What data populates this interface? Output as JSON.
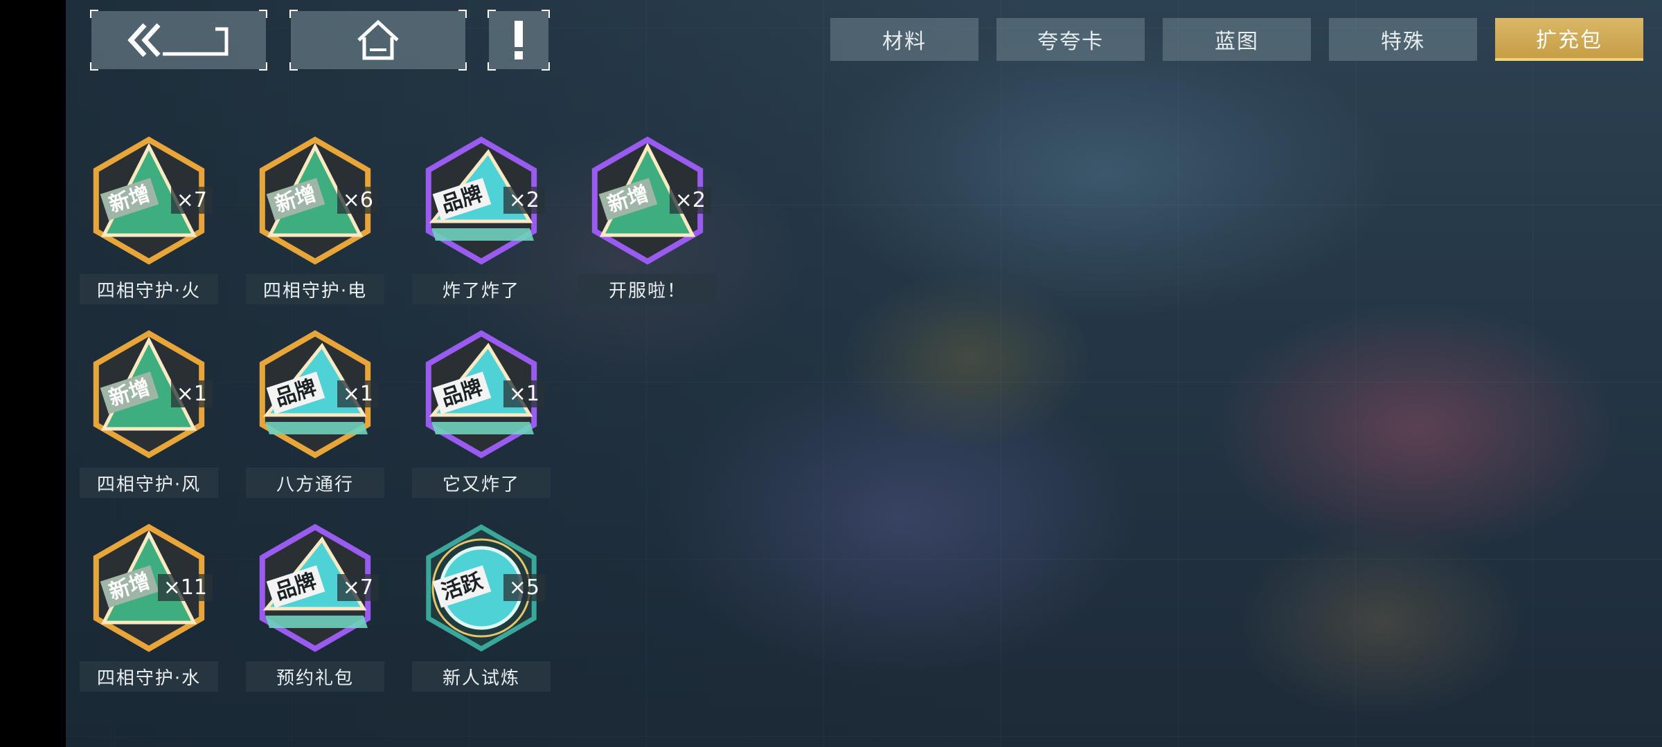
{
  "nav": {
    "back_icon": "double-chevron-back-icon",
    "home_icon": "home-icon",
    "info_icon": "exclamation-icon"
  },
  "tabs": [
    {
      "label": "材料",
      "active": false
    },
    {
      "label": "夸夸卡",
      "active": false
    },
    {
      "label": "蓝图",
      "active": false
    },
    {
      "label": "特殊",
      "active": false
    },
    {
      "label": "扩充包",
      "active": true
    }
  ],
  "colors": {
    "accent_gold": "#d4b062",
    "frame_gold": "#e8a63a",
    "frame_purple": "#9a5cf0",
    "frame_teal": "#3aa79a",
    "gem_green": "#3fae7f",
    "gem_cyan": "#4fd2d6"
  },
  "packs": [
    {
      "name": "四相守护·火",
      "count": "×7",
      "stamp": "新增",
      "frame": "gold"
    },
    {
      "name": "四相守护·电",
      "count": "×6",
      "stamp": "新增",
      "frame": "gold"
    },
    {
      "name": "炸了炸了",
      "count": "×2",
      "stamp": "品牌",
      "frame": "purple"
    },
    {
      "name": "开服啦！",
      "count": "×2",
      "stamp": "新增",
      "frame": "purple"
    },
    {
      "name": "四相守护·风",
      "count": "×1",
      "stamp": "新增",
      "frame": "gold"
    },
    {
      "name": "八方通行",
      "count": "×1",
      "stamp": "品牌",
      "frame": "gold"
    },
    {
      "name": "它又炸了",
      "count": "×1",
      "stamp": "品牌",
      "frame": "purple"
    },
    {
      "name": "四相守护·水",
      "count": "×11",
      "stamp": "新增",
      "frame": "gold"
    },
    {
      "name": "预约礼包",
      "count": "×7",
      "stamp": "品牌",
      "frame": "purple"
    },
    {
      "name": "新人试炼",
      "count": "×5",
      "stamp": "活跃",
      "frame": "teal"
    }
  ]
}
